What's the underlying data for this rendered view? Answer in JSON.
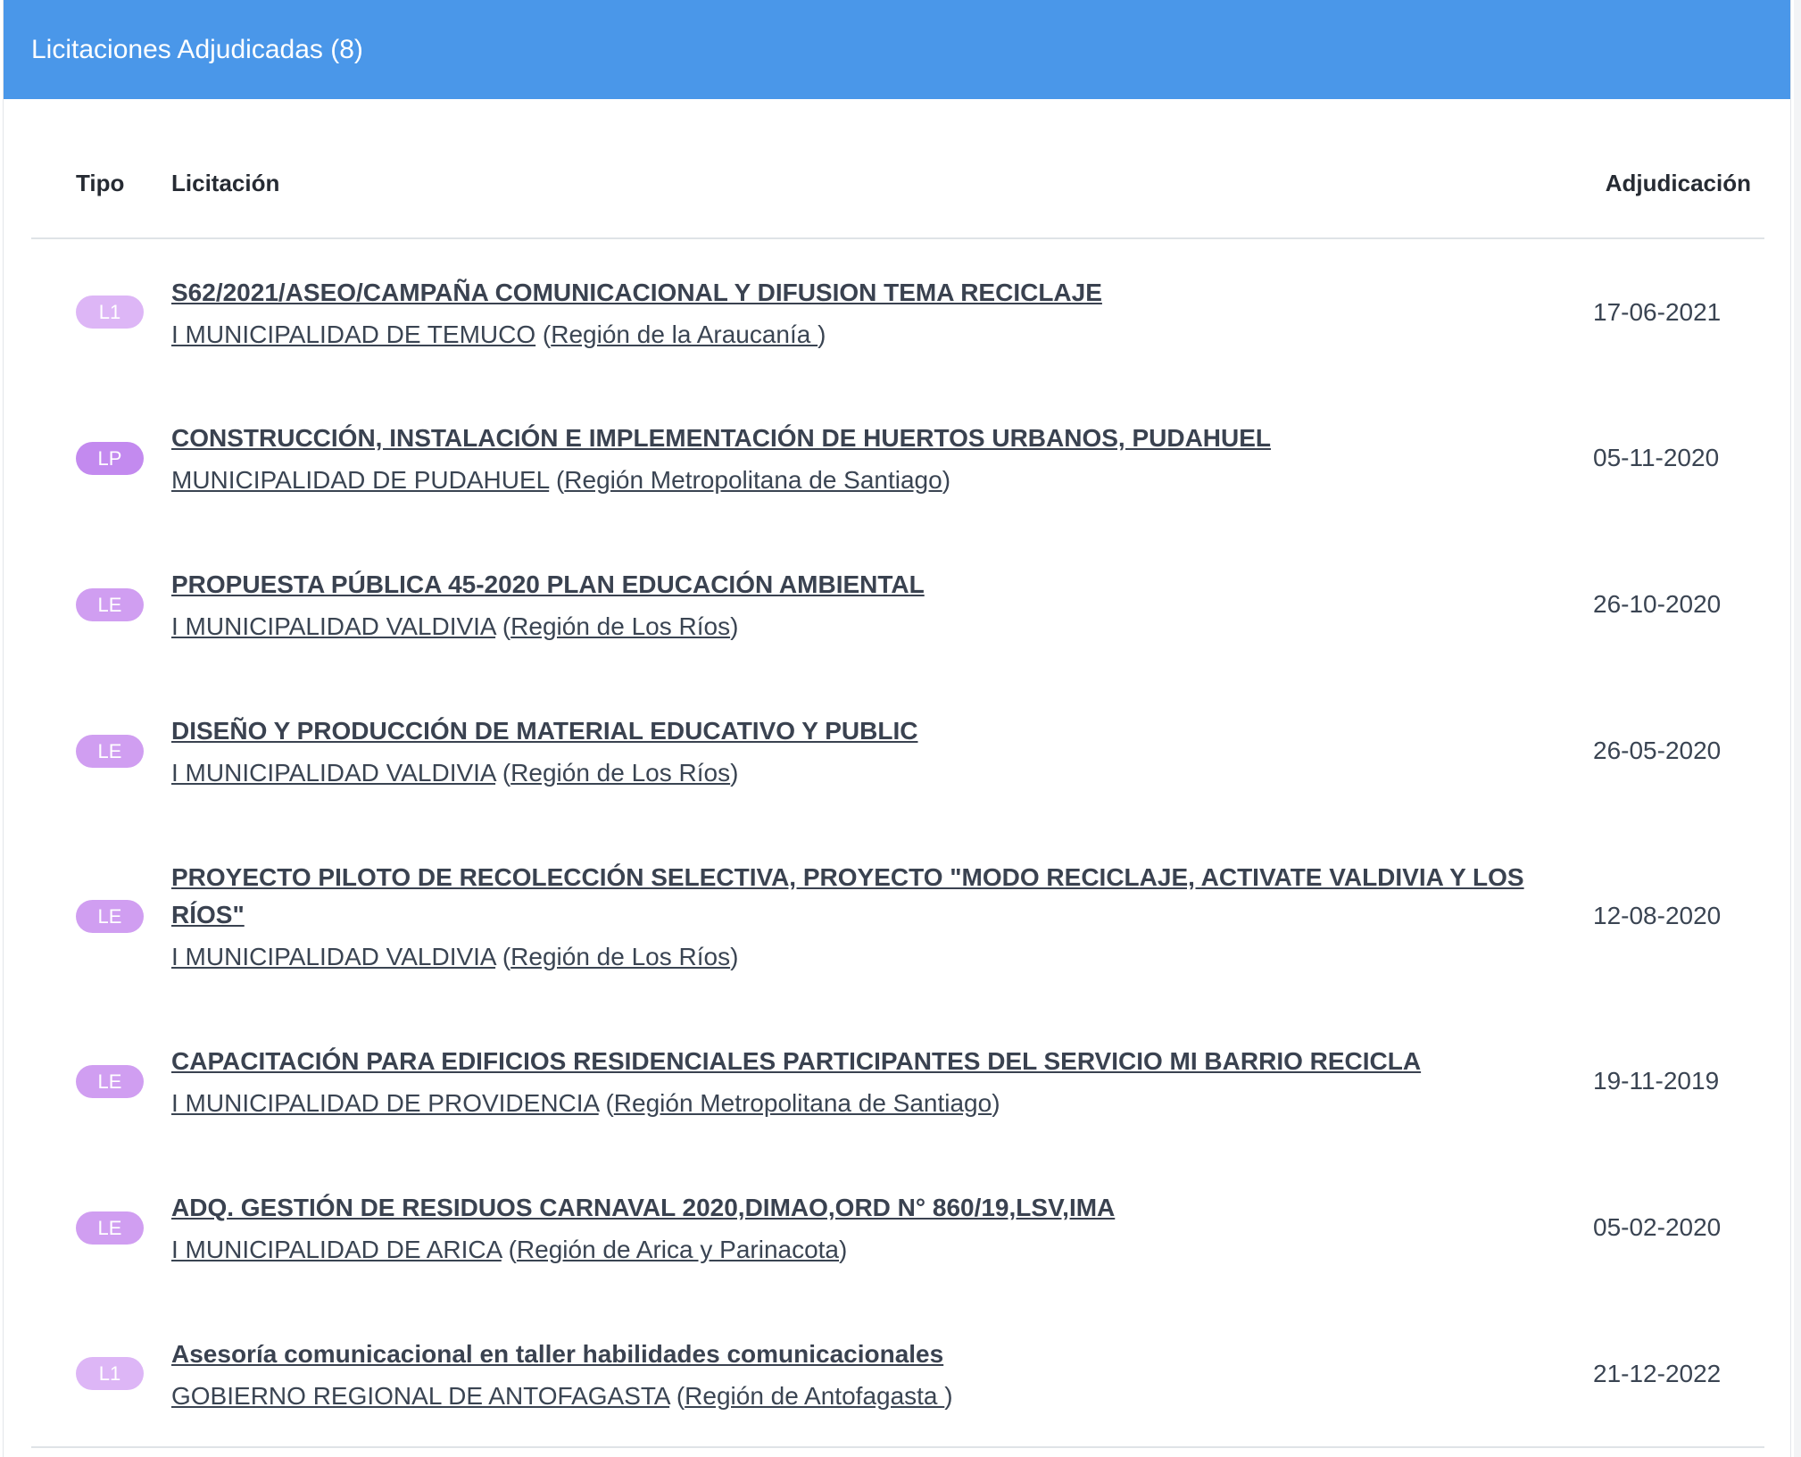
{
  "panel": {
    "title": "Licitaciones Adjudicadas (8)"
  },
  "table": {
    "headers": {
      "tipo": "Tipo",
      "licitacion": "Licitación",
      "adjudicacion": "Adjudicación"
    },
    "rows": [
      {
        "tipo": "L1",
        "title": "S62/2021/ASEO/CAMPAÑA COMUNICACIONAL Y DIFUSION TEMA RECICLAJE",
        "org": "I MUNICIPALIDAD DE TEMUCO",
        "region": "Región de la Araucanía ",
        "fecha": "17-06-2021"
      },
      {
        "tipo": "LP",
        "title": "CONSTRUCCIÓN, INSTALACIÓN E IMPLEMENTACIÓN DE HUERTOS URBANOS, PUDAHUEL",
        "org": "MUNICIPALIDAD DE PUDAHUEL",
        "region": "Región Metropolitana de Santiago",
        "fecha": "05-11-2020"
      },
      {
        "tipo": "LE",
        "title": "PROPUESTA PÚBLICA 45-2020 PLAN EDUCACIÓN AMBIENTAL",
        "org": "I MUNICIPALIDAD VALDIVIA",
        "region": "Región de Los Ríos",
        "fecha": "26-10-2020"
      },
      {
        "tipo": "LE",
        "title": "DISEÑO Y PRODUCCIÓN DE MATERIAL EDUCATIVO Y PUBLIC",
        "org": "I MUNICIPALIDAD VALDIVIA",
        "region": "Región de Los Ríos",
        "fecha": "26-05-2020"
      },
      {
        "tipo": "LE",
        "title": "PROYECTO PILOTO DE RECOLECCIÓN SELECTIVA, PROYECTO \"MODO RECICLAJE, ACTIVATE VALDIVIA Y LOS RÍOS\"",
        "org": "I MUNICIPALIDAD VALDIVIA",
        "region": "Región de Los Ríos",
        "fecha": "12-08-2020"
      },
      {
        "tipo": "LE",
        "title": "CAPACITACIÓN PARA EDIFICIOS RESIDENCIALES PARTICIPANTES DEL SERVICIO MI BARRIO RECICLA",
        "org": "I MUNICIPALIDAD DE PROVIDENCIA",
        "region": "Región Metropolitana de Santiago",
        "fecha": "19-11-2019"
      },
      {
        "tipo": "LE",
        "title": "ADQ. GESTIÓN DE RESIDUOS CARNAVAL 2020,DIMAO,ORD N° 860/19,LSV,IMA",
        "org": "I MUNICIPALIDAD DE ARICA",
        "region": "Región de Arica y Parinacota",
        "fecha": "05-02-2020"
      },
      {
        "tipo": "L1",
        "title": "Asesoría comunicacional en taller habilidades comunicacionales",
        "org": "GOBIERNO REGIONAL DE ANTOFAGASTA",
        "region": "Región de Antofagasta ",
        "fecha": "21-12-2022"
      }
    ]
  },
  "colors": {
    "header_bg": "#4a97e9",
    "badge_L1": "#ddb6f6",
    "badge_LP": "#c38aef",
    "badge_LE": "#d09ef1"
  },
  "punctuation": {
    "open": " (",
    "close": ")"
  }
}
